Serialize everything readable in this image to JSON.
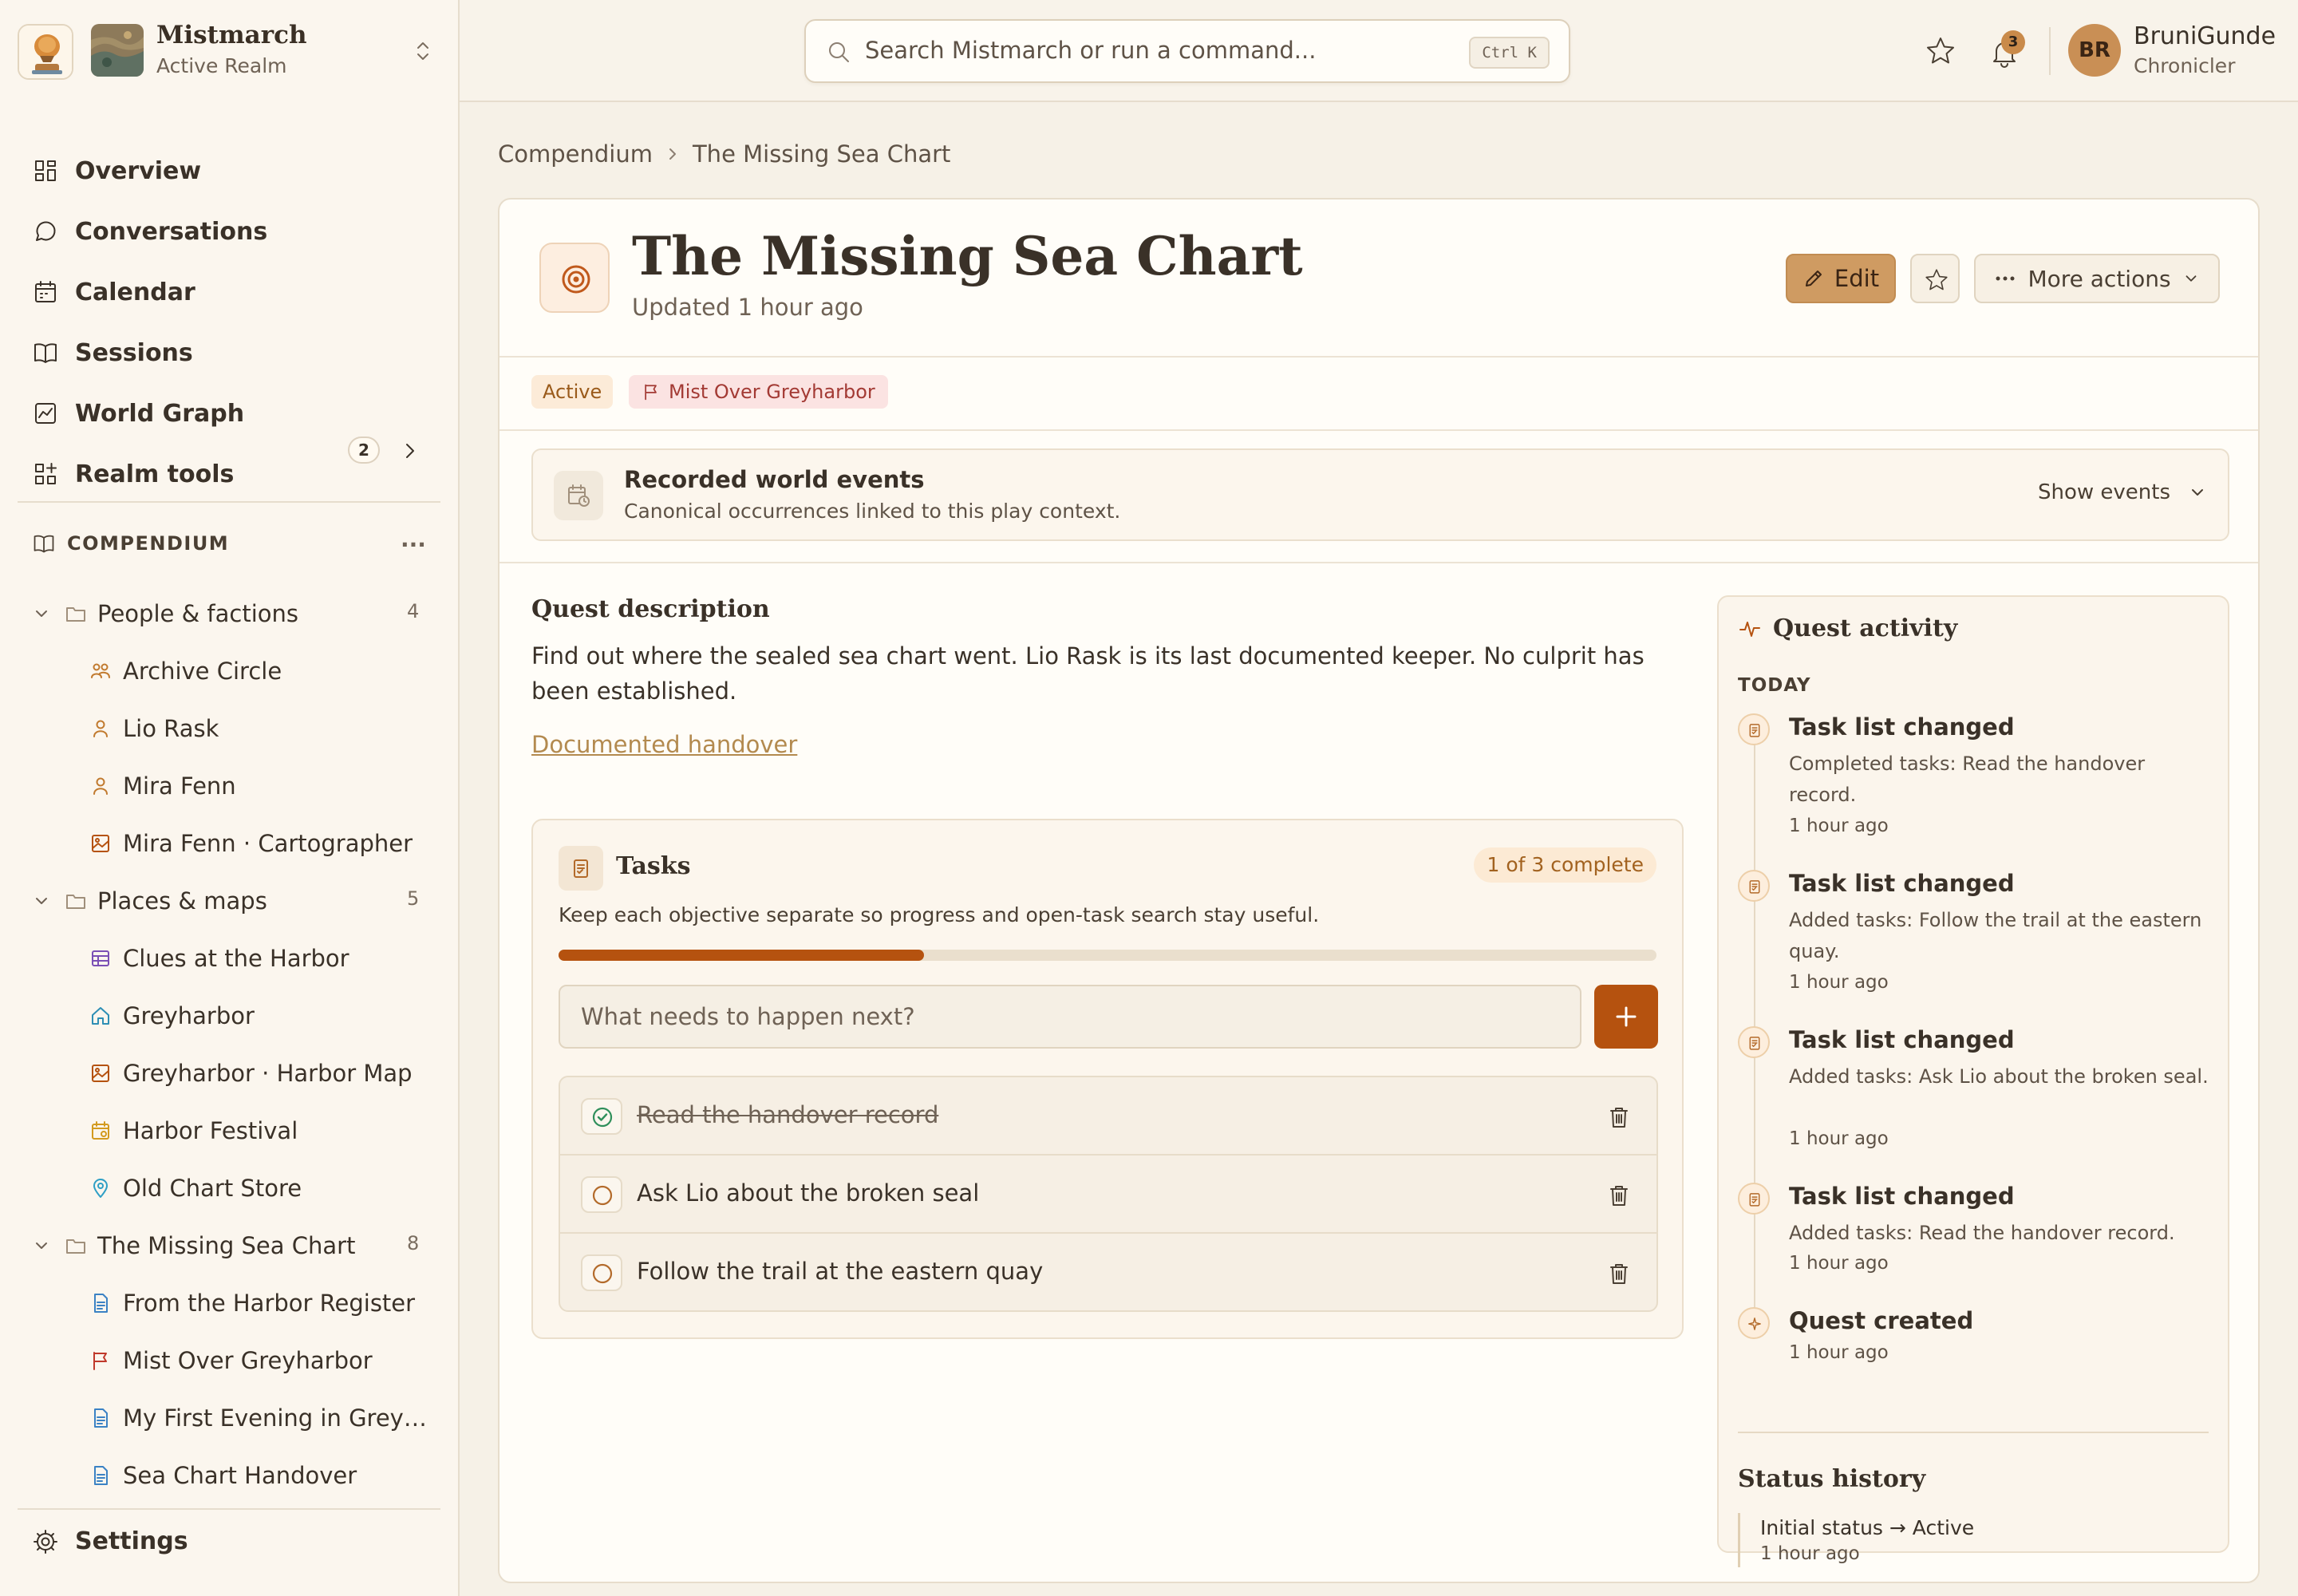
{
  "app": {
    "realm_name": "Mistmarch",
    "realm_status": "Active Realm"
  },
  "search": {
    "placeholder": "Search Mistmarch or run a command...",
    "shortcut": "Ctrl K"
  },
  "notifications": {
    "count": "3"
  },
  "user": {
    "initials": "BR",
    "name": "BruniGunde",
    "role": "Chronicler"
  },
  "sidebar": {
    "nav": [
      {
        "label": "Overview",
        "icon": "grid-icon"
      },
      {
        "label": "Conversations",
        "icon": "chat-bubble-icon"
      },
      {
        "label": "Calendar",
        "icon": "calendar-icon"
      },
      {
        "label": "Sessions",
        "icon": "open-book-icon"
      },
      {
        "label": "World Graph",
        "icon": "chart-icon"
      },
      {
        "label": "Realm tools",
        "icon": "apps-add-icon",
        "count": "2"
      }
    ],
    "compendium_label": "COMPENDIUM",
    "more_label": "···",
    "folders": [
      {
        "label": "People & factions",
        "count": "4",
        "items": [
          {
            "label": "Archive Circle",
            "icon": "group-icon",
            "color": "#c17a2e"
          },
          {
            "label": "Lio Rask",
            "icon": "person-icon",
            "color": "#c17a2e"
          },
          {
            "label": "Mira Fenn",
            "icon": "person-icon",
            "color": "#c17a2e"
          },
          {
            "label": "Mira Fenn · Cartographer",
            "icon": "image-icon",
            "color": "#b5520f"
          }
        ]
      },
      {
        "label": "Places & maps",
        "count": "5",
        "items": [
          {
            "label": "Clues at the Harbor",
            "icon": "table-icon",
            "color": "#7a4fb5"
          },
          {
            "label": "Greyharbor",
            "icon": "home-icon",
            "color": "#2e8fb5"
          },
          {
            "label": "Greyharbor · Harbor Map",
            "icon": "image-icon",
            "color": "#b5520f"
          },
          {
            "label": "Harbor Festival",
            "icon": "calendar-icon",
            "color": "#d39a1f"
          },
          {
            "label": "Old Chart Store",
            "icon": "map-pin-icon",
            "color": "#2e9fc5"
          }
        ]
      },
      {
        "label": "The Missing Sea Chart",
        "count": "8",
        "items": [
          {
            "label": "From the Harbor Register",
            "icon": "document-icon",
            "color": "#3b82c4"
          },
          {
            "label": "Mist Over Greyharbor",
            "icon": "flag-icon",
            "color": "#c0392b"
          },
          {
            "label": "My First Evening in Grey…",
            "icon": "document-icon",
            "color": "#3b82c4"
          },
          {
            "label": "Sea Chart Handover",
            "icon": "document-icon",
            "color": "#3b82c4"
          }
        ]
      }
    ],
    "settings_label": "Settings"
  },
  "breadcrumb": {
    "parent": "Compendium",
    "current": "The Missing Sea Chart"
  },
  "quest": {
    "title": "The Missing Sea Chart",
    "updated": "Updated 1 hour ago",
    "edit_label": "Edit",
    "more_label": "More actions",
    "status_badge": "Active",
    "context_badge": "Mist Over Greyharbor",
    "accent": "#b5520f"
  },
  "events": {
    "title": "Recorded world events",
    "subtitle": "Canonical occurrences linked to this play context.",
    "toggle": "Show events"
  },
  "description": {
    "heading": "Quest description",
    "text": "Find out where the sealed sea chart went. Lio Rask is its last documented keeper. No culprit has been established.",
    "link": "Documented handover"
  },
  "tasks": {
    "title": "Tasks",
    "count_label": "1 of 3 complete",
    "hint": "Keep each objective separate so progress and open-task search stay useful.",
    "progress_fraction": 0.333,
    "input_placeholder": "What needs to happen next?",
    "items": [
      {
        "label": "Read the handover record",
        "done": true
      },
      {
        "label": "Ask Lio about the broken seal",
        "done": false
      },
      {
        "label": "Follow the trail at the eastern quay",
        "done": false
      }
    ]
  },
  "activity": {
    "title": "Quest activity",
    "group_label": "TODAY",
    "items": [
      {
        "title": "Task list changed",
        "detail": "Completed tasks: Read the handover record.",
        "time": "1 hour ago",
        "icon": "task-list-icon"
      },
      {
        "title": "Task list changed",
        "detail": "Added tasks: Follow the trail at the eastern quay.",
        "time": "1 hour ago",
        "icon": "task-list-icon"
      },
      {
        "title": "Task list changed",
        "detail": "Added tasks: Ask Lio about the broken seal.",
        "time": "1 hour ago",
        "icon": "task-list-icon"
      },
      {
        "title": "Task list changed",
        "detail": "Added tasks: Read the handover record.",
        "time": "1 hour ago",
        "icon": "task-list-icon"
      },
      {
        "title": "Quest created",
        "detail": "",
        "time": "1 hour ago",
        "icon": "sparkle-icon"
      }
    ],
    "status_history_title": "Status history",
    "status_history": [
      {
        "text": "Initial status → Active",
        "time": "1 hour ago"
      }
    ]
  }
}
